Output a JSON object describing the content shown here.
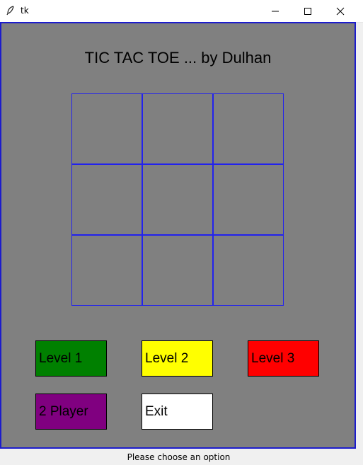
{
  "window": {
    "title": "tk",
    "app_icon": "feather-icon"
  },
  "controls": {
    "minimize_icon": "minimize-icon",
    "maximize_icon": "maximize-icon",
    "close_icon": "close-icon"
  },
  "game": {
    "heading": "TIC TAC TOE ... by Dulhan",
    "canvas_color": "#808080",
    "grid_color": "#2222ee",
    "board_cells": [
      "",
      "",
      "",
      "",
      "",
      "",
      "",
      "",
      ""
    ]
  },
  "buttons": {
    "level1": {
      "label": "Level 1",
      "color": "#008000"
    },
    "level2": {
      "label": "Level 2",
      "color": "#ffff00"
    },
    "level3": {
      "label": "Level 3",
      "color": "#ff0000"
    },
    "two_player": {
      "label": "2 Player",
      "color": "#800080"
    },
    "exit": {
      "label": "Exit",
      "color": "#ffffff"
    }
  },
  "status": {
    "text": "Please choose an option"
  }
}
